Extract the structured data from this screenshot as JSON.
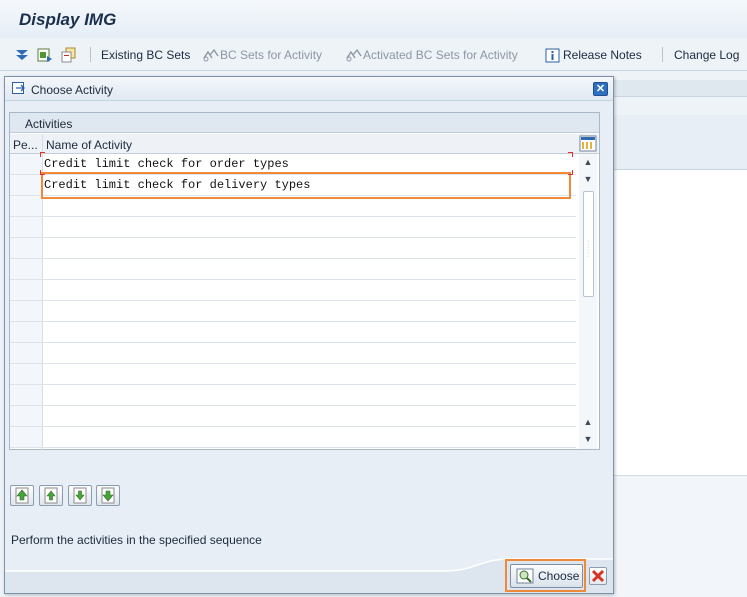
{
  "app": {
    "title": "Display IMG"
  },
  "toolbar": {
    "existing_bc_sets": "Existing BC Sets",
    "bc_sets_for_activity": "BC Sets for Activity",
    "activated_bc_sets": "Activated BC Sets for Activity",
    "release_notes": "Release Notes",
    "change_log": "Change Log",
    "icons": [
      "expand-icon",
      "find-icon",
      "where-used-icon",
      "bc-set-icon",
      "info-icon"
    ]
  },
  "dialog": {
    "title": "Choose Activity",
    "close_icon": "close-icon",
    "table": {
      "caption": "Activities",
      "columns": [
        "Pe...",
        "Name of Activity"
      ],
      "rows": [
        "Credit limit check for order types",
        "Credit limit check for delivery types"
      ]
    },
    "info_text": "Perform the activities in the specified sequence",
    "sequence_buttons": [
      "move-top-icon",
      "move-up-icon",
      "move-down-icon",
      "move-bottom-icon"
    ],
    "choose_label": "Choose",
    "cancel_icon": "cancel-icon"
  },
  "colors": {
    "highlight": "#f0893a",
    "title_text": "#1a2f4d",
    "window_bg": "#eef3f8"
  }
}
